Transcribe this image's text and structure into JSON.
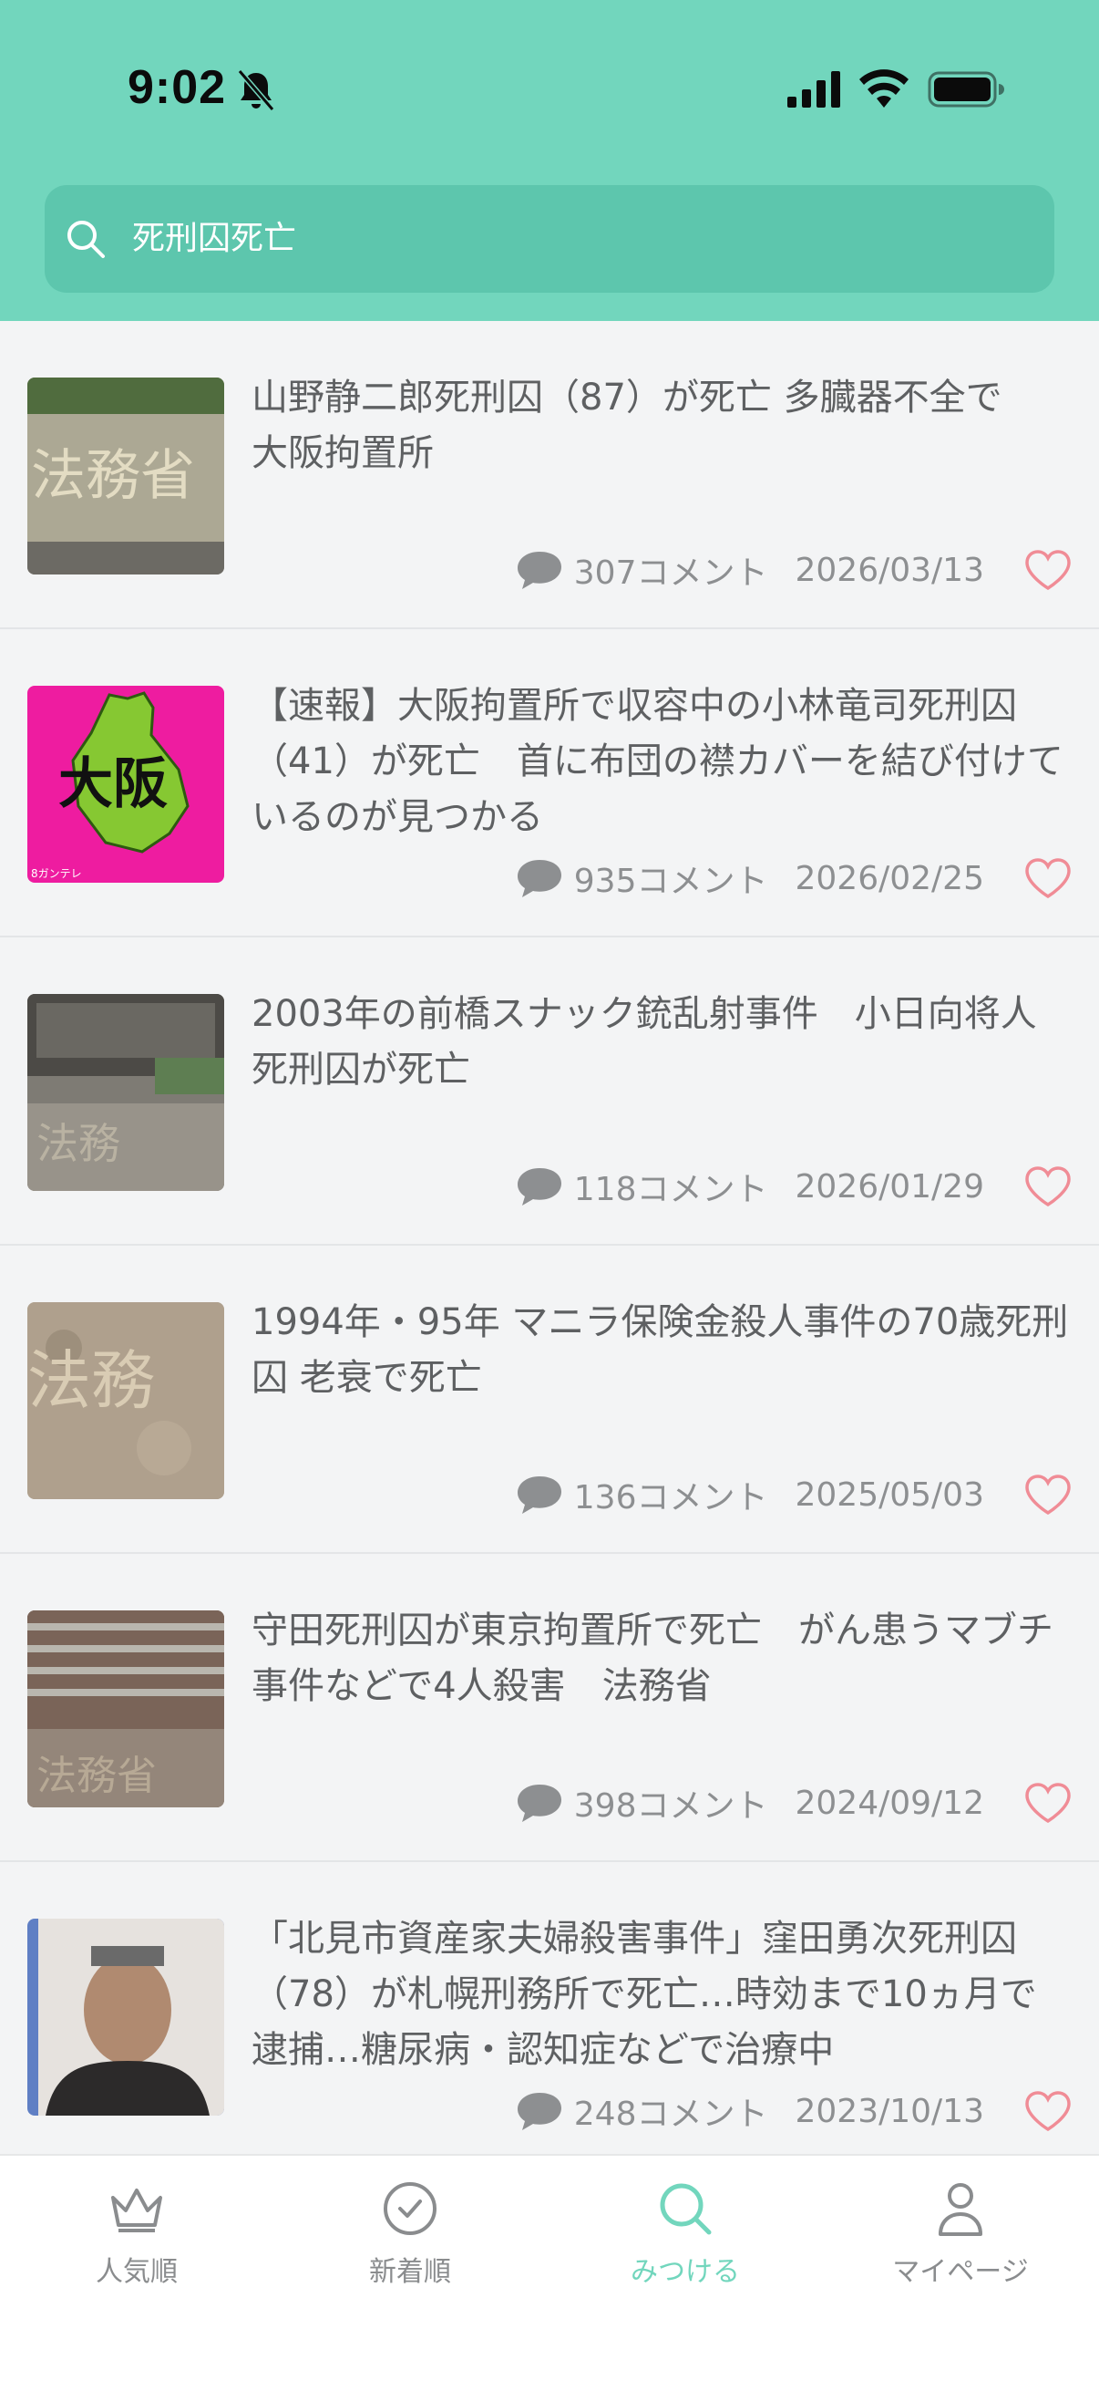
{
  "status_bar": {
    "time": "9:02"
  },
  "search": {
    "query": "死刑囚死亡"
  },
  "articles": [
    {
      "title": "山野静二郎死刑囚（87）が死亡 多臓器不全で　大阪拘置所",
      "comments": "307コメント",
      "date": "2026/03/13",
      "thumb_label": "法務省"
    },
    {
      "title": "【速報】大阪拘置所で収容中の小林竜司死刑囚（41）が死亡　首に布団の襟カバーを結び付けているのが見つかる",
      "comments": "935コメント",
      "date": "2026/02/25",
      "thumb_label": "大阪",
      "thumb_small": "8ガンテレ"
    },
    {
      "title": "2003年の前橋スナック銃乱射事件　小日向将人死刑囚が死亡",
      "comments": "118コメント",
      "date": "2026/01/29",
      "thumb_label": "法務"
    },
    {
      "title": "1994年・95年 マニラ保険金殺人事件の70歳死刑囚 老衰で死亡",
      "comments": "136コメント",
      "date": "2025/05/03",
      "thumb_label": "法務"
    },
    {
      "title": "守田死刑囚が東京拘置所で死亡　がん患うマブチ事件などで4人殺害　法務省",
      "comments": "398コメント",
      "date": "2024/09/12",
      "thumb_label": "法務省"
    },
    {
      "title": "「北見市資産家夫婦殺害事件」窪田勇次死刑囚（78）が札幌刑務所で死亡…時効まで10ヵ月で逮捕…糖尿病・認知症などで治療中",
      "comments": "248コメント",
      "date": "2023/10/13",
      "thumb_label": ""
    }
  ],
  "tabs": [
    {
      "label": "人気順",
      "icon": "crown-icon"
    },
    {
      "label": "新着順",
      "icon": "clock-icon"
    },
    {
      "label": "みつける",
      "icon": "search-icon",
      "active": true
    },
    {
      "label": "マイページ",
      "icon": "person-icon"
    }
  ],
  "colors": {
    "accent": "#72d6bd",
    "search_bg": "#5dc6ad",
    "heart": "#f08c96"
  }
}
